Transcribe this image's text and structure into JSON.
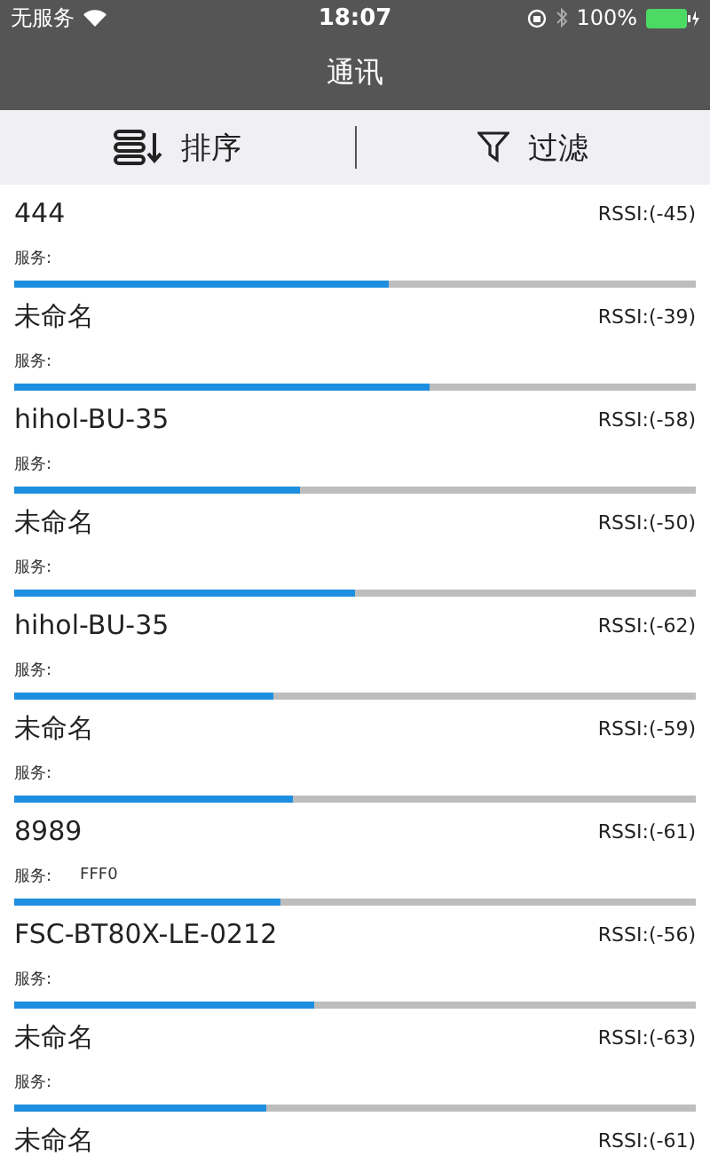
{
  "status_bar": {
    "carrier": "无服务",
    "time": "18:07",
    "battery": "100%"
  },
  "nav": {
    "title": "通讯"
  },
  "toolbar": [
    {
      "kind": "sort",
      "label": "排序"
    },
    {
      "kind": "filter",
      "label": "过滤"
    }
  ],
  "devices": [
    {
      "name": "444",
      "rssi": "RSSI:(-45)",
      "service_label": "服务:",
      "level": 0.55
    },
    {
      "name": "未命名",
      "rssi": "RSSI:(-39)",
      "service_label": "服务:",
      "level": 0.61
    },
    {
      "name": "hihol-BU-35",
      "rssi": "RSSI:(-58)",
      "service_label": "服务:",
      "level": 0.42
    },
    {
      "name": "未命名",
      "rssi": "RSSI:(-50)",
      "service_label": "服务:",
      "level": 0.5
    },
    {
      "name": "hihol-BU-35",
      "rssi": "RSSI:(-62)",
      "service_label": "服务:",
      "level": 0.38
    },
    {
      "name": "未命名",
      "rssi": "RSSI:(-59)",
      "service_label": "服务:",
      "level": 0.41
    },
    {
      "name": "8989",
      "rssi": "RSSI:(-61)",
      "service_label": "服务:",
      "service": "FFF0",
      "level": 0.39
    },
    {
      "name": "FSC-BT80X-LE-0212",
      "rssi": "RSSI:(-56)",
      "service_label": "服务:",
      "level": 0.44
    },
    {
      "name": "未命名",
      "rssi": "RSSI:(-63)",
      "service_label": "服务:",
      "level": 0.37
    },
    {
      "name": "未命名",
      "rssi": "RSSI:(-61)"
    }
  ]
}
